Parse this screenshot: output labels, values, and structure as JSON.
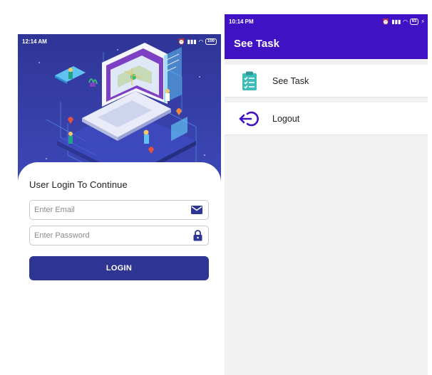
{
  "login_screen": {
    "status_time": "12:14 AM",
    "battery": "100",
    "title": "User Login To Continue",
    "email_placeholder": "Enter Email",
    "password_placeholder": "Enter Password",
    "login_label": "LOGIN"
  },
  "menu_screen": {
    "status_time": "10:14 PM",
    "battery": "63",
    "appbar_title": "See Task",
    "items": [
      {
        "label": "See Task",
        "icon": "clipboard-task-icon"
      },
      {
        "label": "Logout",
        "icon": "logout-icon"
      }
    ]
  },
  "colors": {
    "login_brand": "#2e3593",
    "appbar": "#3f12c4",
    "task_icon": "#3dbcb8",
    "logout_icon": "#3f12c4"
  }
}
